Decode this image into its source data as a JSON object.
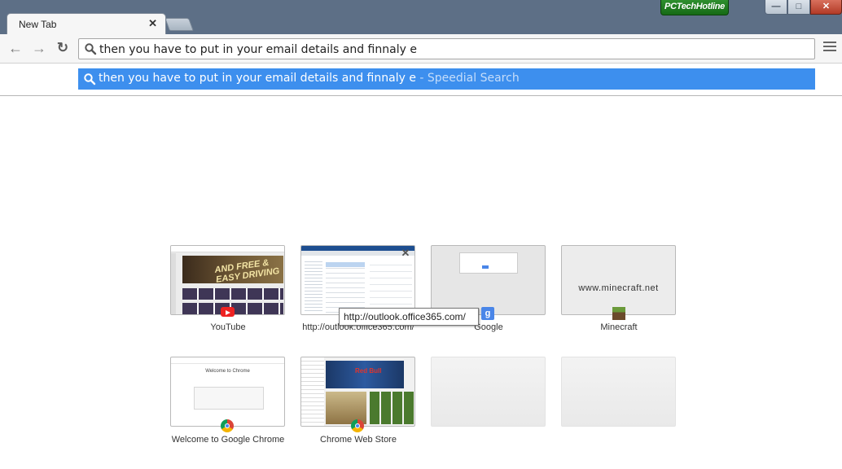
{
  "window": {
    "brand_logo": "PCTechHotline",
    "controls": {
      "minimize": "—",
      "maximize": "□",
      "close": "✕"
    }
  },
  "tab": {
    "title": "New Tab",
    "close_glyph": "✕"
  },
  "toolbar": {
    "back_glyph": "←",
    "forward_glyph": "→",
    "reload_glyph": "↻",
    "omnibox_value": "then you have to put in your email details and finnaly e"
  },
  "dropdown": {
    "suggestion_text": "then you have to put in your email details and finnaly e",
    "suggestion_source": " - Speedial Search"
  },
  "most_visited": [
    {
      "label": "YouTube",
      "favicon": "youtube-icon",
      "thumb_text": "AND FREE & EASY DRIVING"
    },
    {
      "label": "http://outlook.office365.com/",
      "favicon": "",
      "thumb_text": ""
    },
    {
      "label": "Google",
      "favicon": "google-icon",
      "thumb_text": ""
    },
    {
      "label": "Minecraft",
      "favicon": "minecraft-icon",
      "thumb_text": "www.minecraft.net"
    },
    {
      "label": "Welcome to Google Chrome",
      "favicon": "chrome-icon",
      "thumb_text": "Welcome to Chrome"
    },
    {
      "label": "Chrome Web Store",
      "favicon": "chrome-icon",
      "thumb_text": "Red Bull"
    },
    {
      "label": "",
      "favicon": "",
      "thumb_text": ""
    },
    {
      "label": "",
      "favicon": "",
      "thumb_text": ""
    }
  ],
  "tooltip": {
    "text": "http://outlook.office365.com/"
  },
  "colors": {
    "frame": "#5d6f86",
    "selection": "#3d8fee",
    "suggestion_source": "#c5ddfa"
  }
}
